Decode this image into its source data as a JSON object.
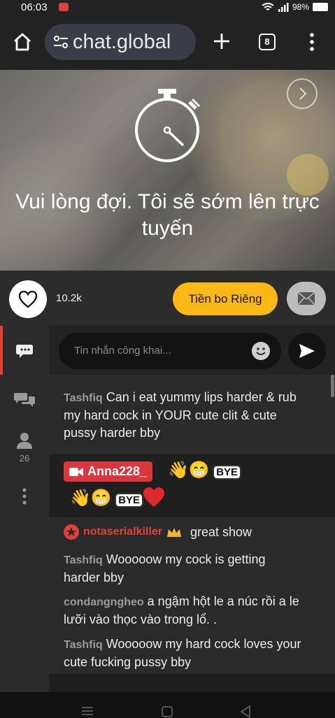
{
  "status_bar": {
    "time": "06:03",
    "battery": "98%"
  },
  "browser": {
    "url": "chat.global",
    "tab_count": "8"
  },
  "stream": {
    "offline_message": "Vui lòng đợi. Tôi sẽ sớm lên trực tuyến"
  },
  "actions": {
    "likes": "10.2k",
    "tip_button": "Tiền bo Riêng"
  },
  "sidebar": {
    "users_count": "26"
  },
  "chat_input": {
    "placeholder": "Tin nhắn công khai..."
  },
  "messages": [
    {
      "user": "Tashfiq",
      "text": "Can i eat yummy lips harder & rub my hard cock in YOUR cute clit & cute pussy harder bby"
    },
    {
      "user": "Anna228_",
      "sticker": "BYE"
    },
    {
      "user": "notaserialkiller",
      "text": "great show"
    },
    {
      "user": "Tashfiq",
      "text": "Wooooow my cock is getting harder bby"
    },
    {
      "user": "condangngheo",
      "text": "a ngậm hột le a núc rồi a le lưỡi vào thọc vào trong lổ. ."
    },
    {
      "user": "Tashfiq",
      "text": "Wooooow my hard cock loves your cute fucking pussy bby"
    }
  ],
  "colors": {
    "accent": "#fcb814",
    "red": "#e0413a",
    "tip_label": "#d9363e"
  }
}
